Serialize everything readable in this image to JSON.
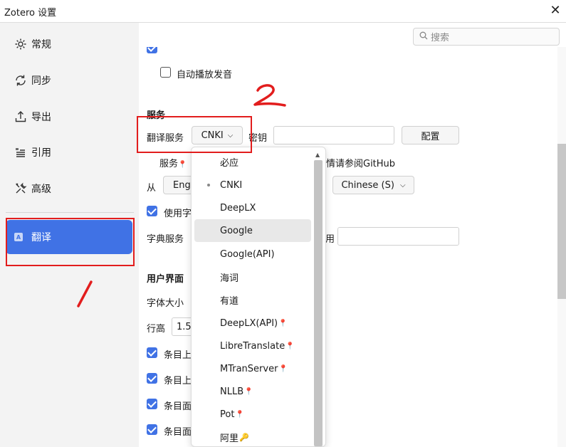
{
  "window": {
    "title": "Zotero 设置"
  },
  "search": {
    "placeholder": "搜索",
    "icon": "search-icon"
  },
  "sidebar": {
    "items": [
      {
        "label": "常规",
        "icon": "gear-icon"
      },
      {
        "label": "同步",
        "icon": "sync-icon"
      },
      {
        "label": "导出",
        "icon": "export-icon"
      },
      {
        "label": "引用",
        "icon": "cite-icon"
      },
      {
        "label": "高级",
        "icon": "tools-icon"
      },
      {
        "label": "翻译",
        "icon": "translate-icon",
        "active": true
      }
    ]
  },
  "content": {
    "autoplay_label": "自动播放发音",
    "services_heading": "服务",
    "translate_service_label": "翻译服务",
    "translate_service_value": "CNKI",
    "key_label": "密钥",
    "config_button": "配置",
    "service_note_prefix": "服务",
    "service_note_suffix": "情请参阅GitHub",
    "from_label": "从",
    "from_value": "Eng",
    "to_value": "Chinese (S)",
    "use_label": "使用字",
    "dict_service_label": "字典服务",
    "dict_suffix": "用",
    "ui_heading": "用户界面",
    "font_size_label": "字体大小",
    "line_height_label": "行高",
    "line_height_value": "1.5",
    "item_labels": [
      "条目上",
      "条目上",
      "条目面",
      "条目面"
    ]
  },
  "dropdown": {
    "items": [
      {
        "label": "必应"
      },
      {
        "label": "CNKI",
        "selected": true
      },
      {
        "label": "DeepLX"
      },
      {
        "label": "Google",
        "hover": true
      },
      {
        "label": "Google(API)"
      },
      {
        "label": "海词"
      },
      {
        "label": "有道"
      },
      {
        "label": "DeepLX(API)",
        "badge": "pin-icon"
      },
      {
        "label": "LibreTranslate",
        "badge": "pin-icon"
      },
      {
        "label": "MTranServer",
        "badge": "pin-icon"
      },
      {
        "label": "NLLB",
        "badge": "pin-icon"
      },
      {
        "label": "Pot",
        "badge": "pin-icon"
      },
      {
        "label": "阿里",
        "badge": "key-icon"
      }
    ]
  },
  "annotations": {
    "one": "1",
    "two": "2",
    "color": "#e21d1d"
  },
  "colors": {
    "accent": "#4072e5"
  }
}
